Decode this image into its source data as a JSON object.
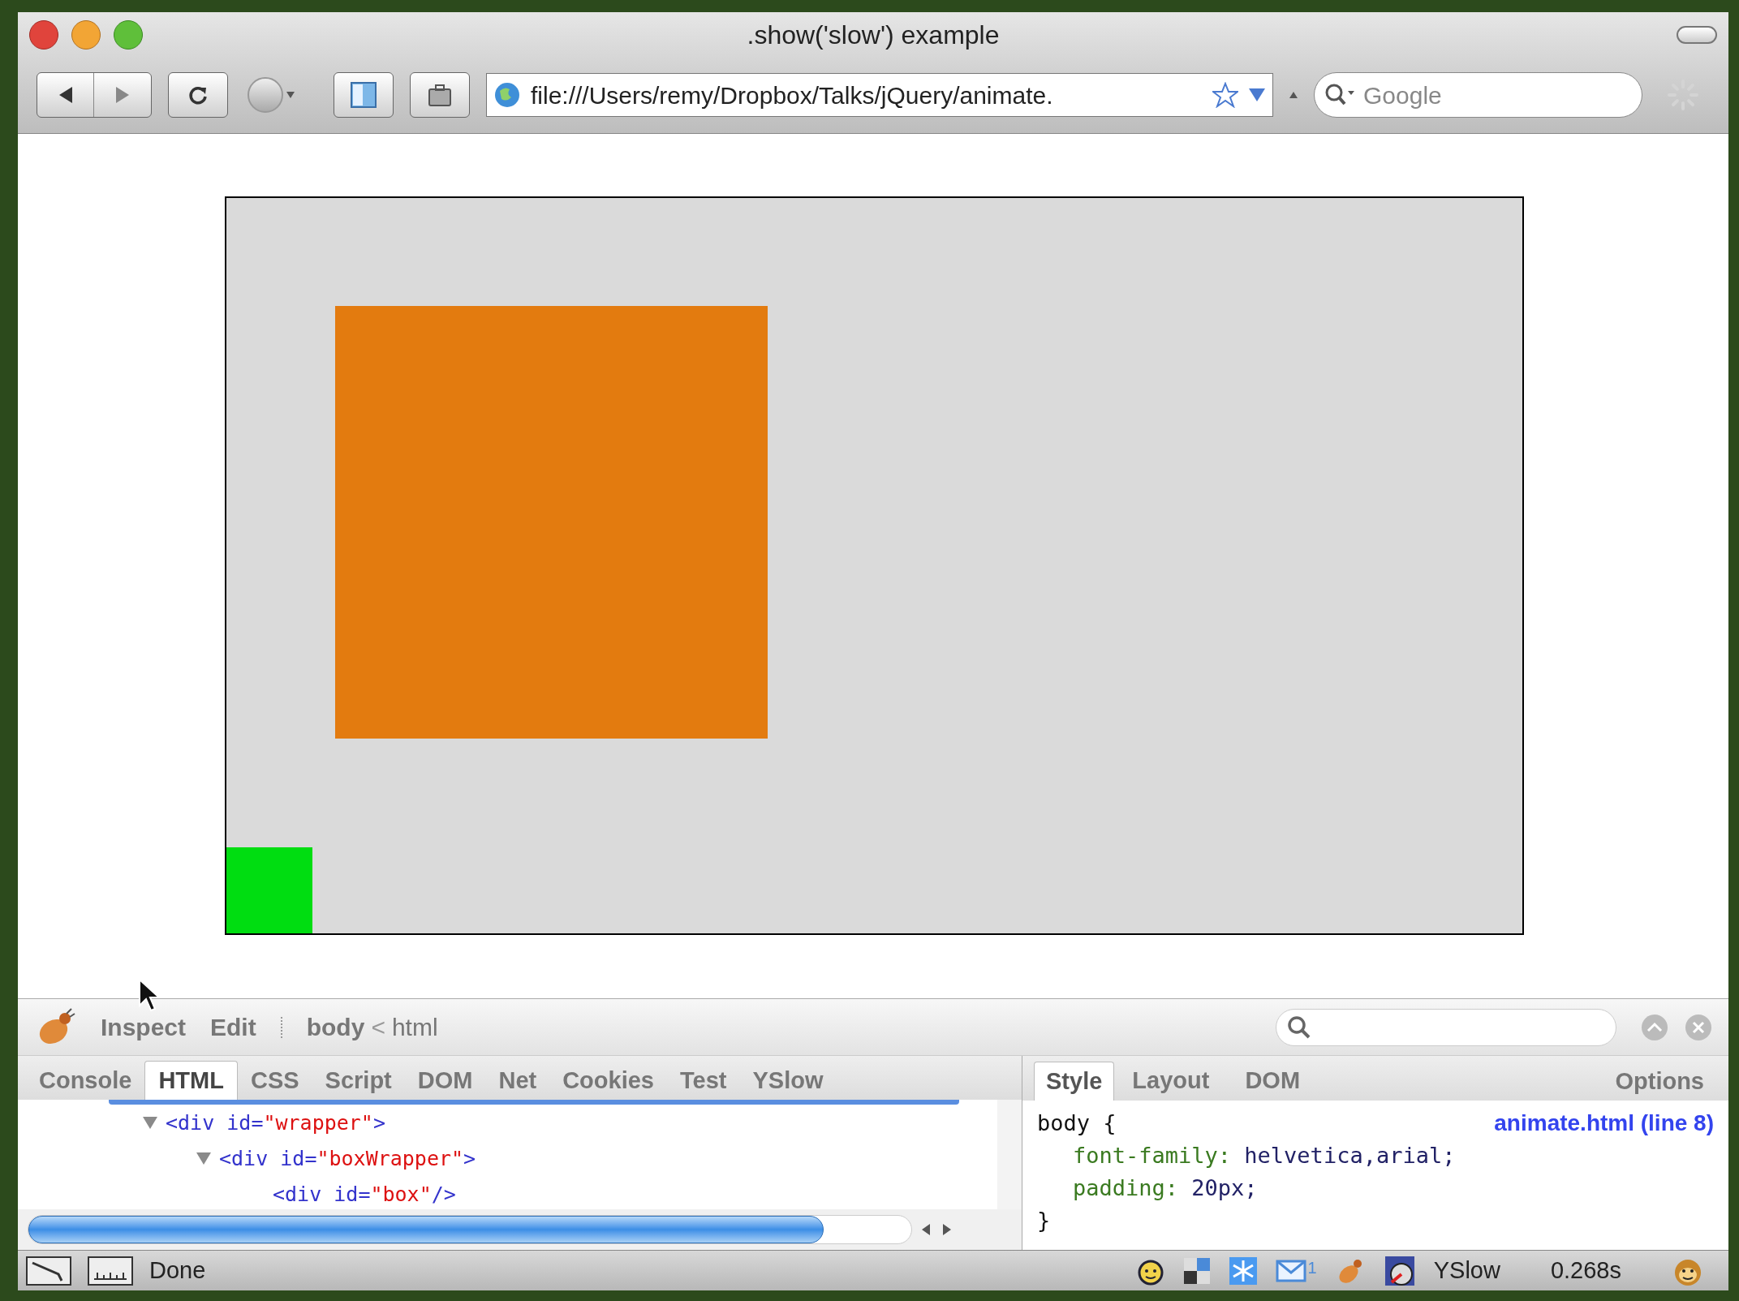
{
  "window": {
    "title": ".show('slow') example"
  },
  "toolbar": {
    "address": "file:///Users/remy/Dropbox/Talks/jQuery/animate.",
    "search": {
      "placeholder": "Google"
    }
  },
  "firebug": {
    "commands": [
      {
        "label": "Inspect"
      },
      {
        "label": "Edit"
      }
    ],
    "breadcrumb": [
      {
        "label": "body",
        "kind": "element"
      },
      {
        "label": "<",
        "kind": "separator"
      },
      {
        "label": "html",
        "kind": "element"
      }
    ],
    "tabs": [
      {
        "label": "Console",
        "selected": false
      },
      {
        "label": "HTML",
        "selected": true
      },
      {
        "label": "CSS",
        "selected": false
      },
      {
        "label": "Script",
        "selected": false
      },
      {
        "label": "DOM",
        "selected": false
      },
      {
        "label": "Net",
        "selected": false
      },
      {
        "label": "Cookies",
        "selected": false
      },
      {
        "label": "Test",
        "selected": false
      },
      {
        "label": "YSlow",
        "selected": false
      }
    ],
    "html_tree": [
      {
        "open": "<div",
        "attr": "id=",
        "value": "\"wrapper\"",
        "close": ">",
        "expanded": true,
        "children": [
          {
            "open": "<div",
            "attr": "id=",
            "value": "\"boxWrapper\"",
            "close": ">",
            "expanded": true,
            "children": [
              {
                "open": "<div",
                "attr": "id=",
                "value": "\"box\"",
                "close": "/>"
              }
            ]
          }
        ]
      }
    ],
    "side_tabs": [
      {
        "label": "Style",
        "selected": true
      },
      {
        "label": "Layout",
        "selected": false
      },
      {
        "label": "DOM",
        "selected": false
      }
    ],
    "options": "Options",
    "css_rule": {
      "source": "animate.html (line 8)",
      "selector": "body {",
      "properties": [
        {
          "name": "font-family:",
          "value": "helvetica,arial;"
        },
        {
          "name": "padding:",
          "value": "20px;"
        }
      ],
      "close": "}"
    }
  },
  "status_bar": {
    "text": "Done",
    "mail_count": "1",
    "yslow": "YSlow",
    "time": "0.268s"
  }
}
